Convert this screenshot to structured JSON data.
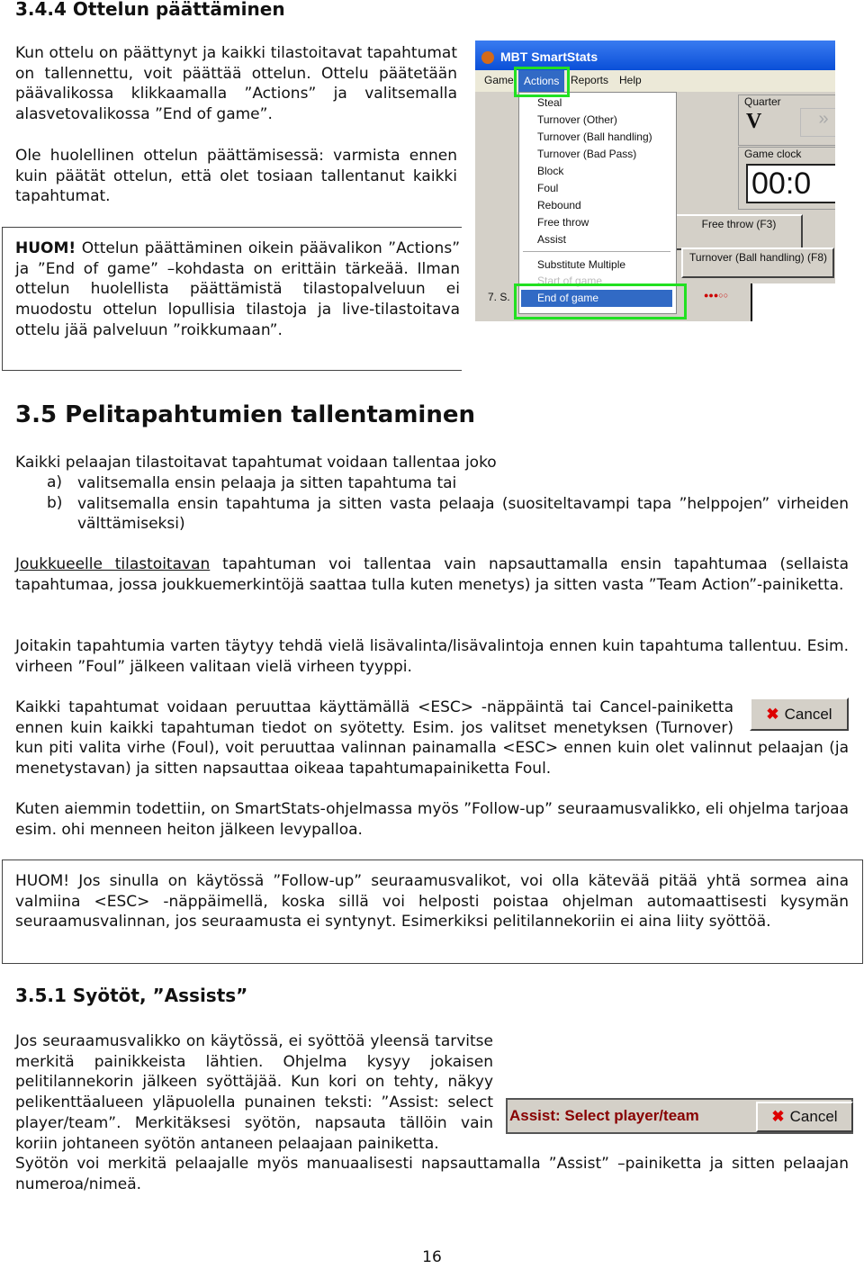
{
  "s344": {
    "title": "3.4.4   Ottelun päättäminen",
    "p1": "Kun ottelu on päättynyt ja kaikki tilastoitavat tapahtumat on tallennettu, voit päättää ottelun. Ottelu päätetään päävalikossa klikkaamalla ”Actions” ja valitsemalla alasvetovalikossa ”End of game”.",
    "p2": "Ole huolellinen ottelun päättämisessä: varmista ennen kuin päätät ottelun, että olet tosiaan tallentanut kaikki tapahtumat.",
    "note_lead": "HUOM!",
    "note": " Ottelun päättäminen oikein päävalikon ”Actions” ja ”End of game” –kohdasta on erittäin tärkeää. Ilman ottelun huolellista päättämistä tilastopalveluun ei muodostu ottelun lopullisia tilastoja ja live-tilastoitava ottelu jää palveluun ”roikkumaan”."
  },
  "screenshot": {
    "app_title": "MBT SmartStats",
    "menu": [
      "Game",
      "Actions",
      "Reports",
      "Help"
    ],
    "items": [
      "Steal",
      "Turnover (Other)",
      "Turnover (Ball handling)",
      "Turnover (Bad Pass)",
      "Block",
      "Foul",
      "Rebound",
      "Free throw",
      "Assist"
    ],
    "substitute": "Substitute Multiple",
    "start": "Start of game",
    "end": "End of game",
    "quarter_label": "Quarter",
    "quarter_value": "V",
    "clock_label": "Game clock",
    "clock_value": "00:0",
    "free_throw": "Free throw (F3)",
    "turnover": "Turnover (Ball handling) (F8)",
    "row_label": "7. S.",
    "fouls": "●●●○○"
  },
  "s35": {
    "title": "3.5   Pelitapahtumien tallentaminen",
    "intro": "Kaikki pelaajan tilastoitavat tapahtumat voidaan tallentaa joko",
    "list": [
      {
        "m": "a)",
        "t": "valitsemalla ensin pelaaja ja sitten tapahtuma tai"
      },
      {
        "m": "b)",
        "t": "valitsemalla ensin tapahtuma ja sitten vasta pelaaja (suositeltavampi tapa ”helppojen” virheiden välttämiseksi)"
      }
    ],
    "p_team_link": "Joukkueelle tilastoitavan",
    "p_team": " tapahtuman voi tallentaa vain napsauttamalla ensin tapahtumaa (sellaista tapahtumaa, jossa joukkuemerkintöjä saattaa tulla kuten menetys) ja sitten vasta ”Team Action”-painiketta.",
    "p_extra": "Joitakin tapahtumia varten täytyy tehdä vielä lisävalinta/lisävalintoja ennen kuin tapahtuma tallentuu. Esim. virheen ”Foul” jälkeen valitaan vielä virheen tyyppi.",
    "p_cancel": "Kaikki tapahtumat voidaan peruuttaa käyttämällä <ESC> -näppäintä tai Cancel-painiketta ennen kuin kaikki tapahtuman tiedot on syötetty. Esim. jos valitset menetyksen (Turnover) kun piti valita virhe (Foul), voit peruuttaa valinnan painamalla <ESC> ennen kuin olet valinnut pelaajan (ja menetystavan) ja sitten napsauttaa oikeaa tapahtumapainiketta Foul.",
    "cancel_label": "Cancel",
    "p_follow": "Kuten aiemmin todettiin, on SmartStats-ohjelmassa myös ”Follow-up” seuraamusvalikko, eli ohjelma tarjoaa esim. ohi menneen heiton jälkeen levypalloa.",
    "note": "HUOM! Jos sinulla on käytössä ”Follow-up” seuraamusvalikot, voi olla kätevää pitää yhtä sormea aina valmiina <ESC> -näppäimellä, koska sillä voi helposti poistaa ohjelman automaattisesti kysymän seuraamusvalinnan, jos seuraamusta ei syntynyt. Esimerkiksi pelitilannekoriin ei aina liity syöttöä."
  },
  "s351": {
    "title": "3.5.1   Syötöt, ”Assists”",
    "p1": "Jos seuraamusvalikko on käytössä, ei syöttöä yleensä tarvitse merkitä painikkeista lähtien. Ohjelma kysyy jokaisen pelitilannekorin jälkeen syöttäjää. Kun kori on tehty, näkyy pelikenttäalueen yläpuolella punainen teksti: ”Assist: select player/team”. Merkitäksesi syötön, napsauta tällöin vain koriin johtaneen syötön antaneen pelaajaan painiketta.",
    "assist_prompt": "Assist: Select player/team",
    "cancel_label": "Cancel",
    "p2": "Syötön voi merkitä pelaajalle myös manuaalisesti napsauttamalla ”Assist” –painiketta ja sitten pelaajan numeroa/nimeä."
  },
  "page_number": "16"
}
